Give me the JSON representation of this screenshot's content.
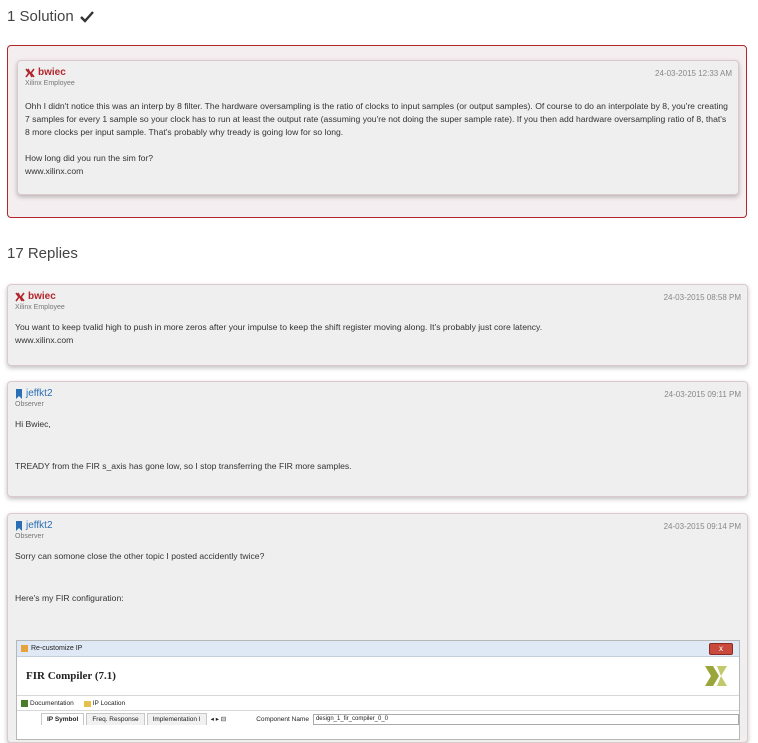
{
  "solution_section": {
    "title": "1 Solution"
  },
  "solution_post": {
    "author": "bwiec",
    "role": "Xilinx Employee",
    "date": "24-03-2015 12:33 AM",
    "paragraph1": "Ohh I didn't notice this was an interp by 8 filter. The hardware oversampling is the ratio of clocks to input samples (or output samples). Of course to do an interpolate by 8, you're creating 7 samples for every 1 sample so your clock has to run at least the output rate (assuming you're not doing the super sample rate). If you then add hardware oversampling ratio of 8, that's 8 more clocks per input sample. That's probably why tready is going low for so long.",
    "paragraph2": "How long did you run the sim for?",
    "signature": "www.xilinx.com"
  },
  "replies_section": {
    "title": "17 Replies"
  },
  "replies": [
    {
      "author": "bwiec",
      "role": "Xilinx Employee",
      "date": "24-03-2015 08:58 PM",
      "text1": "You want to keep tvalid high to push in more zeros after your impulse to keep the shift register moving along. It's probably just core latency.",
      "signature": "www.xilinx.com"
    },
    {
      "author": "jeffkt2",
      "role": "Observer",
      "date": "24-03-2015 09:11 PM",
      "text1": "Hi Bwiec,",
      "text2": "TREADY from the FIR s_axis has gone low, so I stop transferring the FIR more samples."
    },
    {
      "author": "jeffkt2",
      "role": "Observer",
      "date": "24-03-2015 09:14 PM",
      "text1": "Sorry can somone close the other topic I posted accidently twice?",
      "text2": "Here's my FIR configuration:",
      "screenshot": {
        "window_title": "Re-customize IP",
        "close_label": "x",
        "heading": "FIR Compiler (7.1)",
        "doc_link": "Documentation",
        "location_link": "IP Location",
        "tabs": [
          "IP Symbol",
          "Freq. Response",
          "Implementation I"
        ],
        "component_name_label": "Component Name",
        "component_name_value": "design_1_fir_compiler_0_0"
      }
    }
  ],
  "colors": {
    "xilinx_red": "#b3262e",
    "observer_blue": "#2a6fb5"
  }
}
